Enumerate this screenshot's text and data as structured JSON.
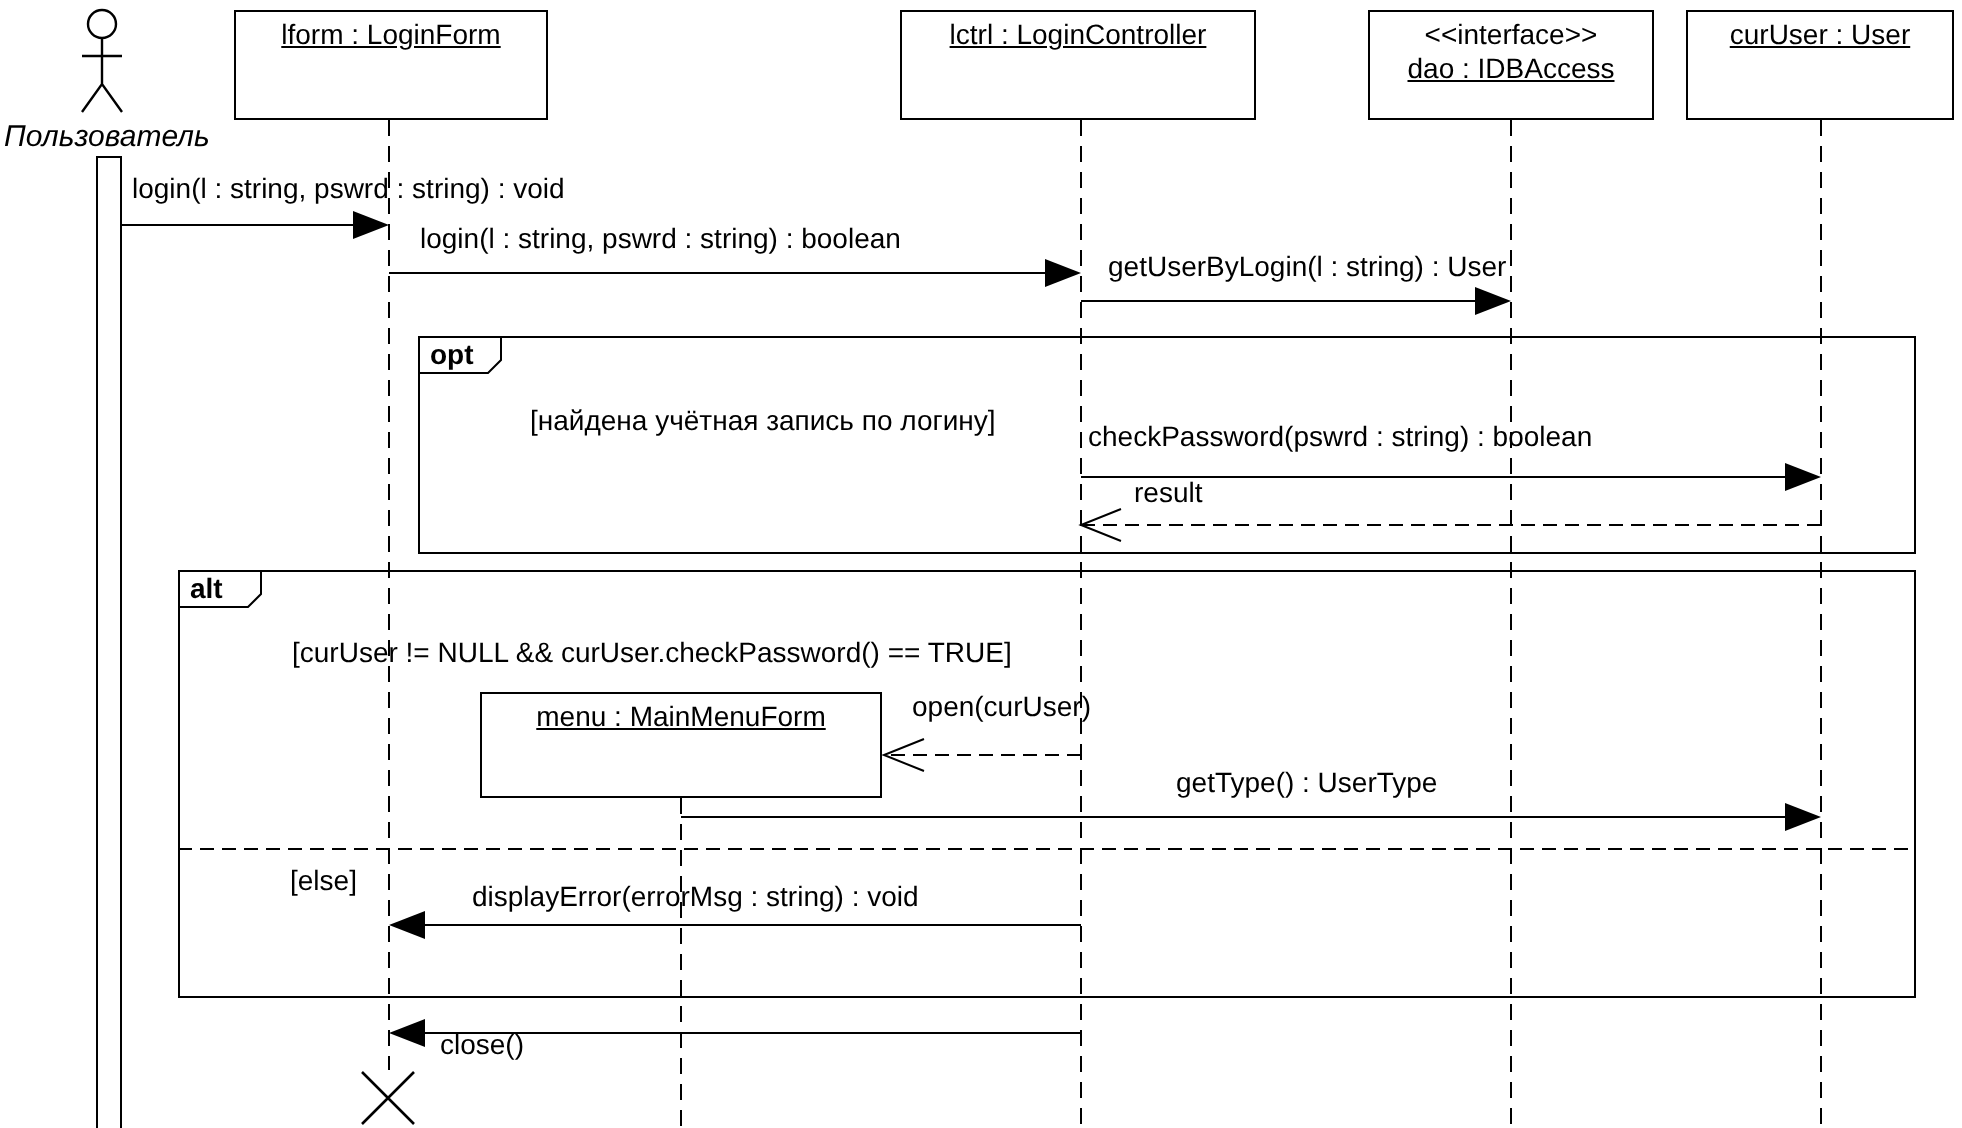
{
  "participants": [
    {
      "kind": "actor",
      "name": "Пользователь"
    },
    {
      "kind": "object",
      "name": "lform : LoginForm",
      "destroyed": true
    },
    {
      "kind": "object",
      "name": "lctrl : LoginController"
    },
    {
      "kind": "object",
      "stereotype": "<<interface>>",
      "name": "dao : IDBAccess"
    },
    {
      "kind": "object",
      "name": "curUser : User"
    },
    {
      "kind": "object",
      "name": "menu : MainMenuForm"
    }
  ],
  "messages": [
    {
      "kind": "call",
      "label": "login(l : string, pswrd : string) : void"
    },
    {
      "kind": "call",
      "label": "login(l : string, pswrd : string) : boolean"
    },
    {
      "kind": "call",
      "label": "getUserByLogin(l : string) : User"
    },
    {
      "kind": "call",
      "label": "checkPassword(pswrd : string) : boolean"
    },
    {
      "kind": "return",
      "label": "result"
    },
    {
      "kind": "create",
      "label": "open(curUser)"
    },
    {
      "kind": "call",
      "label": "getType() : UserType"
    },
    {
      "kind": "call",
      "label": "displayError(errorMsg : string) : void"
    },
    {
      "kind": "call",
      "label": "close()"
    }
  ],
  "fragments": [
    {
      "operator": "opt",
      "operands": [
        {
          "guard": "[найдена учётная запись по логину]"
        }
      ]
    },
    {
      "operator": "alt",
      "operands": [
        {
          "guard": "[curUser != NULL && curUser.checkPassword() == TRUE]"
        },
        {
          "guard": "[else]"
        }
      ]
    }
  ]
}
